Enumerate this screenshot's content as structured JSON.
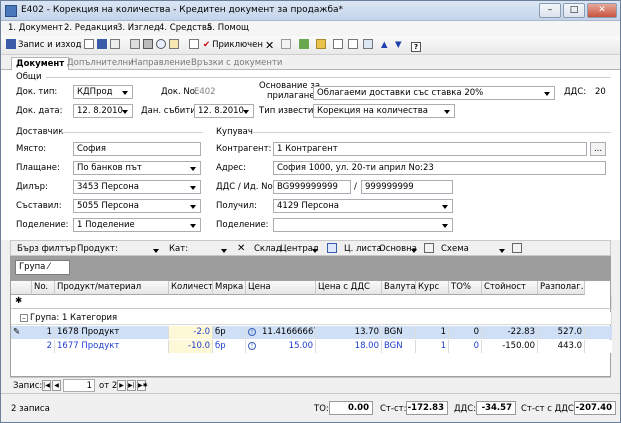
{
  "window": {
    "title": "E402 - Корекция на количества - Кредитен документ за продажба*"
  },
  "menu": [
    "1. Документ",
    "2. Редакция",
    "3. Изглед",
    "4. Средства",
    "5. Помощ"
  ],
  "toolbar": {
    "save_close": "Запис и изход",
    "close": "Приключен"
  },
  "tabs": [
    "Документ",
    "Допълнителни",
    "Направление",
    "Връзки с документи"
  ],
  "general": {
    "section": "Общи",
    "doc_type_label": "Док. тип:",
    "doc_type": "КДПрод",
    "doc_no_label": "Док. No.",
    "doc_no": "E402",
    "basis_label_1": "Основание за",
    "basis_label_2": "прилагане:",
    "basis": "Облагаеми доставки със ставка 20%",
    "vat_label": "ДДС:",
    "vat": "20",
    "doc_date_label": "Док. дата:",
    "doc_date": "12. 8.2010",
    "event_date_label": "Дан. събитие:",
    "event_date": "12. 8.2010",
    "notice_type_label": "Тип известие:",
    "notice_type": "Корекция на количества"
  },
  "supplier": {
    "section": "Доставчик",
    "place_label": "Място:",
    "place": "София",
    "payment_label": "Плащане:",
    "payment": "По банков път",
    "dealer_label": "Дилър:",
    "dealer": "3453 Персона",
    "author_label": "Съставил:",
    "author": "5055 Персона",
    "division_label": "Поделение:",
    "division": "1 Поделение"
  },
  "buyer": {
    "section": "Купувач",
    "partner_label": "Контрагент:",
    "partner": "1 Контрагент",
    "address_label": "Адрес:",
    "address": "София 1000, ул. 20-ти април No:23",
    "vat_id_label": "ДДС / Ид. No.",
    "vat_no": "BG999999999",
    "id_no": "999999999",
    "receiver_label": "Получил:",
    "receiver": "4129 Персона",
    "division_label": "Поделение:",
    "division": ""
  },
  "filter": {
    "quick_filter": "Бърз филтър",
    "product_label": "Продукт:",
    "cat_label": "Кат:",
    "warehouse_label": "Склад",
    "warehouse": "Централ",
    "price_list_label": "Ц. листа",
    "price_list": "Основна",
    "scheme_label": "Схема"
  },
  "group_by_chip": "Група",
  "grid": {
    "columns": [
      "No.",
      "Продукт/материал",
      "Количест...",
      "Мярка",
      "Цена",
      "Цена с ДДС",
      "Валута",
      "Курс",
      "ТО%",
      "Стойност",
      "Разполаг..."
    ],
    "group_row": "Група: 1 Категория",
    "rows": [
      {
        "no": "1",
        "product": "1678 Продукт",
        "qty": "-2.0",
        "unit": "бр",
        "price": "11.41666667",
        "price_vat": "13.70",
        "currency": "BGN",
        "rate": "1",
        "to": "0",
        "value": "-22.83",
        "avail": "527.0"
      },
      {
        "no": "2",
        "product": "1677 Продукт",
        "qty": "-10.0",
        "unit": "бр",
        "price": "15.00",
        "price_vat": "18.00",
        "currency": "BGN",
        "rate": "1",
        "to": "0",
        "value": "-150.00",
        "avail": "443.0"
      }
    ]
  },
  "nav": {
    "record_label": "Запис:",
    "current": "1",
    "of": "от 2"
  },
  "status": {
    "records": "2 записа",
    "to_label": "ТО:",
    "to": "0.00",
    "st_label": "Ст-ст:",
    "st": "-172.83",
    "vat_label": "ДДС:",
    "vat": "-34.57",
    "st_vat_label": "Ст-ст с ДДС:",
    "st_vat": "-207.40"
  }
}
